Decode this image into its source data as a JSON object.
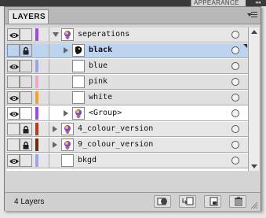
{
  "window": {
    "appearance_tab": "APPEARANCE",
    "collapse_glyph": "◂◂"
  },
  "panel": {
    "tab_label": "LAYERS",
    "layer_count": "4 Layers"
  },
  "layers": [
    {
      "label": "seperations",
      "color": "#9b4ddf",
      "visible": true,
      "locked": false,
      "expanded": true,
      "level": 0,
      "thumb": "bird"
    },
    {
      "label": "black",
      "color": "",
      "visible": false,
      "locked": true,
      "expanded": false,
      "level": 1,
      "thumb": "dark",
      "selected": true
    },
    {
      "label": "blue",
      "color": "#9aa6e8",
      "visible": true,
      "locked": false,
      "level": 1,
      "thumb": "blank"
    },
    {
      "label": "pink",
      "color": "#f0a6c8",
      "visible": false,
      "locked": false,
      "level": 1,
      "thumb": "blank"
    },
    {
      "label": "white",
      "color": "#f4a133",
      "visible": true,
      "locked": false,
      "level": 1,
      "thumb": "blank"
    },
    {
      "label": "<Group>",
      "color": "#9b4ddf",
      "visible": true,
      "locked": false,
      "expanded": false,
      "level": 1,
      "thumb": "bird"
    },
    {
      "label": "4_colour_version",
      "color": "#b83a1c",
      "visible": false,
      "locked": true,
      "expanded": false,
      "level": 0,
      "thumb": "bird"
    },
    {
      "label": "9_colour_version",
      "color": "#7a2a0c",
      "visible": false,
      "locked": true,
      "expanded": false,
      "level": 0,
      "thumb": "bird"
    },
    {
      "label": "bkgd",
      "color": "#9aa6e8",
      "visible": true,
      "locked": false,
      "level": 0,
      "thumb": "blank"
    }
  ],
  "bottom_buttons": [
    "make-clipping-mask-icon",
    "new-sublayer-icon",
    "new-layer-icon",
    "trash-icon"
  ]
}
